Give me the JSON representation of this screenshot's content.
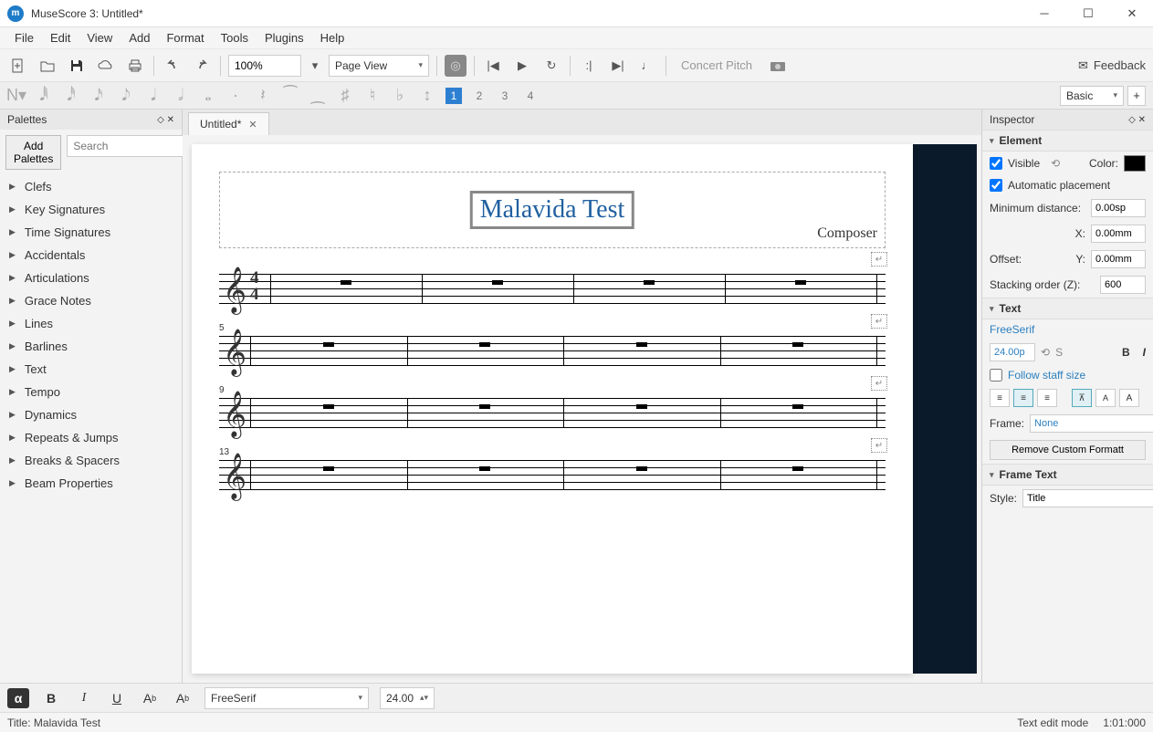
{
  "window": {
    "title": "MuseScore 3: Untitled*"
  },
  "menubar": [
    "File",
    "Edit",
    "View",
    "Add",
    "Format",
    "Tools",
    "Plugins",
    "Help"
  ],
  "toolbar": {
    "zoom": "100%",
    "view_mode": "Page View",
    "concert_pitch": "Concert Pitch",
    "feedback": "Feedback"
  },
  "note_toolbar": {
    "voices": [
      "1",
      "2",
      "3",
      "4"
    ],
    "active_voice": 0,
    "workspace": "Basic"
  },
  "palettes": {
    "title": "Palettes",
    "add_btn": "Add Palettes",
    "search_placeholder": "Search",
    "items": [
      "Clefs",
      "Key Signatures",
      "Time Signatures",
      "Accidentals",
      "Articulations",
      "Grace Notes",
      "Lines",
      "Barlines",
      "Text",
      "Tempo",
      "Dynamics",
      "Repeats & Jumps",
      "Breaks & Spacers",
      "Beam Properties"
    ]
  },
  "tabs": [
    {
      "label": "Untitled*"
    }
  ],
  "score": {
    "title": "Malavida Test",
    "composer": "Composer",
    "time_sig_top": "4",
    "time_sig_bot": "4",
    "systems": [
      {
        "start_measure": "",
        "show_timesig": true
      },
      {
        "start_measure": "5",
        "show_timesig": false
      },
      {
        "start_measure": "9",
        "show_timesig": false
      },
      {
        "start_measure": "13",
        "show_timesig": false
      }
    ]
  },
  "inspector": {
    "title": "Inspector",
    "element": {
      "header": "Element",
      "visible_label": "Visible",
      "visible": true,
      "color_label": "Color:",
      "auto_place_label": "Automatic placement",
      "auto_place": true,
      "min_dist_label": "Minimum distance:",
      "min_dist": "0.00sp",
      "offset_label": "Offset:",
      "offset_x_label": "X:",
      "offset_x": "0.00mm",
      "offset_y_label": "Y:",
      "offset_y": "0.00mm",
      "stacking_label": "Stacking order (Z):",
      "stacking": "600"
    },
    "text": {
      "header": "Text",
      "font": "FreeSerif",
      "size": "24.00p",
      "follow_label": "Follow staff size",
      "follow": false,
      "bold": "B",
      "italic": "I",
      "s_btn": "S",
      "frame_label": "Frame:",
      "frame_value": "None",
      "remove_btn": "Remove Custom Formatt"
    },
    "frame_text": {
      "header": "Frame Text",
      "style_label": "Style:",
      "style_value": "Title"
    }
  },
  "text_toolbar": {
    "font": "FreeSerif",
    "size": "24.00"
  },
  "statusbar": {
    "left": "Title: Malavida Test",
    "mode": "Text edit mode",
    "pos": "1:01:000"
  }
}
